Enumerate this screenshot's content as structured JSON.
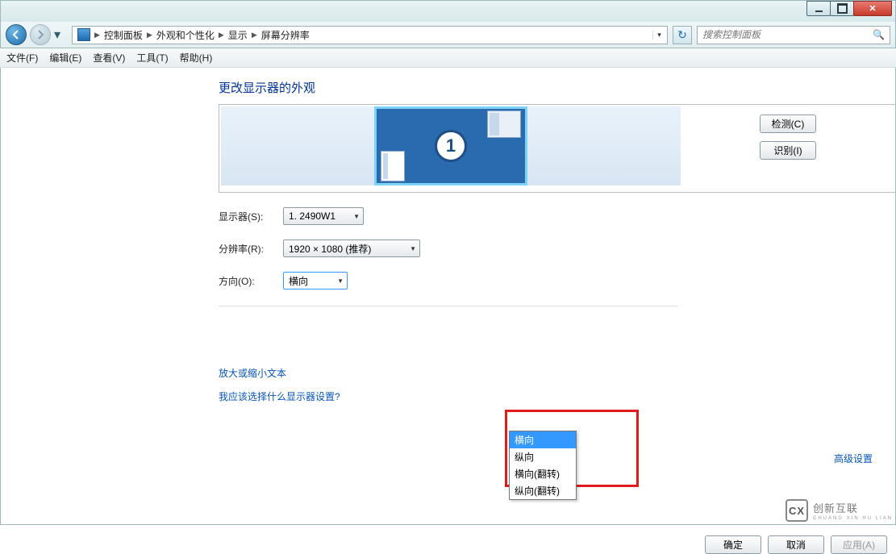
{
  "breadcrumb": {
    "root": "控制面板",
    "lvl1": "外观和个性化",
    "lvl2": "显示",
    "lvl3": "屏幕分辨率"
  },
  "search": {
    "placeholder": "搜索控制面板"
  },
  "menu": {
    "file": "文件(F)",
    "edit": "编辑(E)",
    "view": "查看(V)",
    "tools": "工具(T)",
    "help": "帮助(H)"
  },
  "page": {
    "title": "更改显示器的外观",
    "detect": "检测(C)",
    "identify": "识别(I)",
    "monitor_number": "1"
  },
  "form": {
    "display_label": "显示器(S):",
    "display_value": "1. 2490W1",
    "resolution_label": "分辨率(R):",
    "resolution_value": "1920 × 1080 (推荐)",
    "orientation_label": "方向(O):",
    "orientation_value": "横向",
    "orientation_options": {
      "o1": "横向",
      "o2": "纵向",
      "o3": "横向(翻转)",
      "o4": "纵向(翻转)"
    }
  },
  "links": {
    "advanced": "高级设置",
    "resize": "放大或缩小文本",
    "which": "我应该选择什么显示器设置?"
  },
  "footer": {
    "ok": "确定",
    "cancel": "取消",
    "apply": "应用(A)"
  },
  "watermark": {
    "brand": "创新互联",
    "sub": "CHUANG XIN HU LIAN",
    "logo": "CX"
  }
}
